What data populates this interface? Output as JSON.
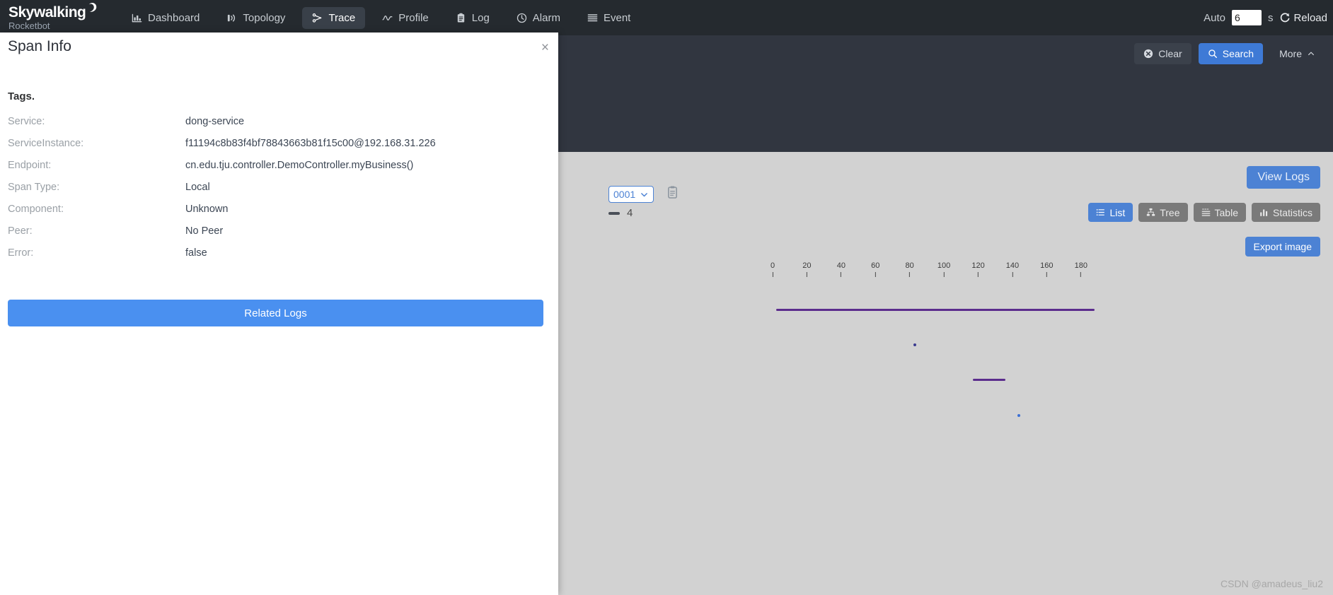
{
  "brand": {
    "name": "Skywalking",
    "sub": "Rocketbot",
    "moon_icon": "moon-icon"
  },
  "nav": {
    "items": [
      {
        "label": "Dashboard",
        "icon": "dashboard-icon",
        "active": false
      },
      {
        "label": "Topology",
        "icon": "topology-icon",
        "active": false
      },
      {
        "label": "Trace",
        "icon": "trace-icon",
        "active": true
      },
      {
        "label": "Profile",
        "icon": "profile-icon",
        "active": false
      },
      {
        "label": "Log",
        "icon": "log-icon",
        "active": false
      },
      {
        "label": "Alarm",
        "icon": "alarm-icon",
        "active": false
      },
      {
        "label": "Event",
        "icon": "event-icon",
        "active": false
      }
    ],
    "auto_label": "Auto",
    "auto_value": "6",
    "auto_unit": "s",
    "reload_label": "Reload",
    "reload_icon": "refresh-icon"
  },
  "search_bar": {
    "clear_label": "Clear",
    "clear_icon": "close-circle-icon",
    "search_label": "Search",
    "search_icon": "search-icon",
    "more_label": "More",
    "more_icon": "chevron-up-icon"
  },
  "content": {
    "view_logs_label": "View Logs",
    "trace_id_partial": "0001",
    "trace_select_icon": "chevron-down-icon",
    "copy_icon": "copy-icon",
    "span_count": "4",
    "span_pill_text": "",
    "export_label": "Export image",
    "view_tabs": [
      {
        "label": "List",
        "icon": "list-icon",
        "active": true
      },
      {
        "label": "Tree",
        "icon": "tree-icon",
        "active": false
      },
      {
        "label": "Table",
        "icon": "table-icon",
        "active": false
      },
      {
        "label": "Statistics",
        "icon": "statistics-icon",
        "active": false
      }
    ],
    "watermark": "CSDN @amadeus_liu2"
  },
  "chart_data": {
    "type": "bar",
    "title": "",
    "xlabel": "",
    "ylabel": "",
    "grid": false,
    "legend": "none",
    "axis_ticks": [
      0,
      20,
      40,
      60,
      80,
      100,
      120,
      140,
      160,
      180
    ],
    "xlim": [
      0,
      190
    ],
    "spans": [
      {
        "start": 2,
        "end": 188,
        "row": 0,
        "color": "#5b2c8d",
        "shape": "bar"
      },
      {
        "start": 82,
        "end": 83,
        "row": 1,
        "color": "#3b3b8f",
        "shape": "dot"
      },
      {
        "start": 117,
        "end": 136,
        "row": 2,
        "color": "#5b2c8d",
        "shape": "bar"
      },
      {
        "start": 143,
        "end": 144,
        "row": 3,
        "color": "#3b6fd4",
        "shape": "dot"
      }
    ]
  },
  "modal": {
    "title": "Span Info",
    "close_icon": "close-icon",
    "tags_heading": "Tags.",
    "rows": [
      {
        "key": "Service:",
        "value": "dong-service"
      },
      {
        "key": "ServiceInstance:",
        "value": "f11194c8b83f4bf78843663b81f15c00@192.168.31.226"
      },
      {
        "key": "Endpoint:",
        "value": "cn.edu.tju.controller.DemoController.myBusiness()"
      },
      {
        "key": "Span Type:",
        "value": "Local"
      },
      {
        "key": "Component:",
        "value": "Unknown"
      },
      {
        "key": "Peer:",
        "value": "No Peer"
      },
      {
        "key": "Error:",
        "value": "false"
      }
    ],
    "related_logs_label": "Related Logs"
  },
  "colors": {
    "nav_bg": "#252a2f",
    "panel_bg": "#313640",
    "page_bg": "#d2d2d2",
    "accent_blue": "#4c82d4",
    "span_purple": "#5b2c8d"
  }
}
